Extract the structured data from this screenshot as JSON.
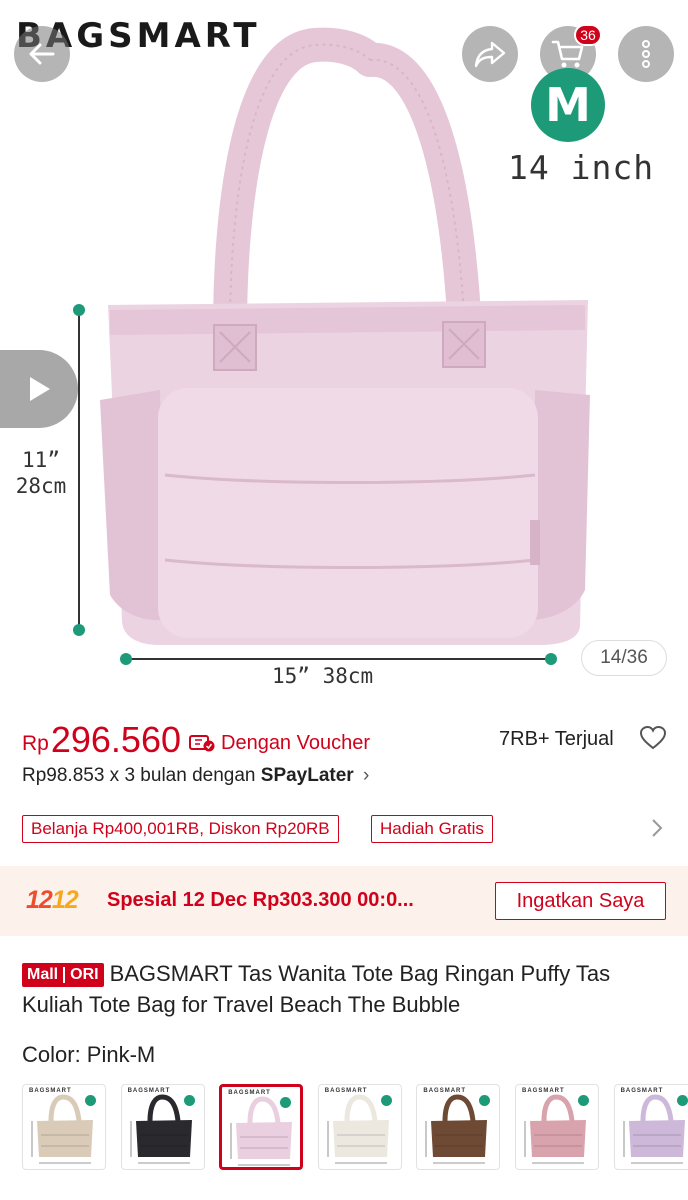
{
  "hero": {
    "brand": "BAGSMART",
    "size_letter": "M",
    "size_inch": "14 inch",
    "height_label_in": "11”",
    "height_label_cm": "28cm",
    "width_label": "15”  38cm",
    "image_counter": "14/36",
    "cart_count": "36",
    "bag_color": "#e9cfe0"
  },
  "price": {
    "currency": "Rp",
    "value": "296.560",
    "voucher_label": "Dengan Voucher",
    "sold": "7RB+ Terjual"
  },
  "paylater": {
    "text": "Rp98.853 x 3 bulan dengan ",
    "brand": "SPayLater",
    "chevron": "›"
  },
  "promos": [
    "Belanja Rp400,001RB, Diskon Rp20RB",
    "Hadiah Gratis"
  ],
  "flash_sale": {
    "logo_a": "12",
    "logo_b": "12",
    "text": "Spesial 12 Dec Rp303.300 00:0...",
    "remind_button": "Ingatkan Saya"
  },
  "product": {
    "badge_mall": "Mall",
    "badge_ori": "ORI",
    "title": "BAGSMART Tas Wanita Tote Bag Ringan Puffy Tas Kuliah Tote Bag for Travel Beach The Bubble",
    "color_label": "Color: ",
    "color_value": "Pink-M"
  },
  "variants": [
    {
      "logo": "BAGSMART",
      "color": "#d9cbb8",
      "selected": false
    },
    {
      "logo": "BAGSMART",
      "color": "#2a2a2e",
      "selected": false
    },
    {
      "logo": "BAGSMART",
      "color": "#e9cfe0",
      "selected": true
    },
    {
      "logo": "BAGSMART",
      "color": "#ece8e0",
      "selected": false
    },
    {
      "logo": "BAGSMART",
      "color": "#6e4a35",
      "selected": false
    },
    {
      "logo": "BAGSMART",
      "color": "#d9a3ad",
      "selected": false
    },
    {
      "logo": "BAGSMART",
      "color": "#cdb8da",
      "selected": false
    }
  ],
  "colors": {
    "accent": "#d0011b",
    "brand_green": "#1d9a78",
    "banner_bg": "#fdf1ec"
  }
}
